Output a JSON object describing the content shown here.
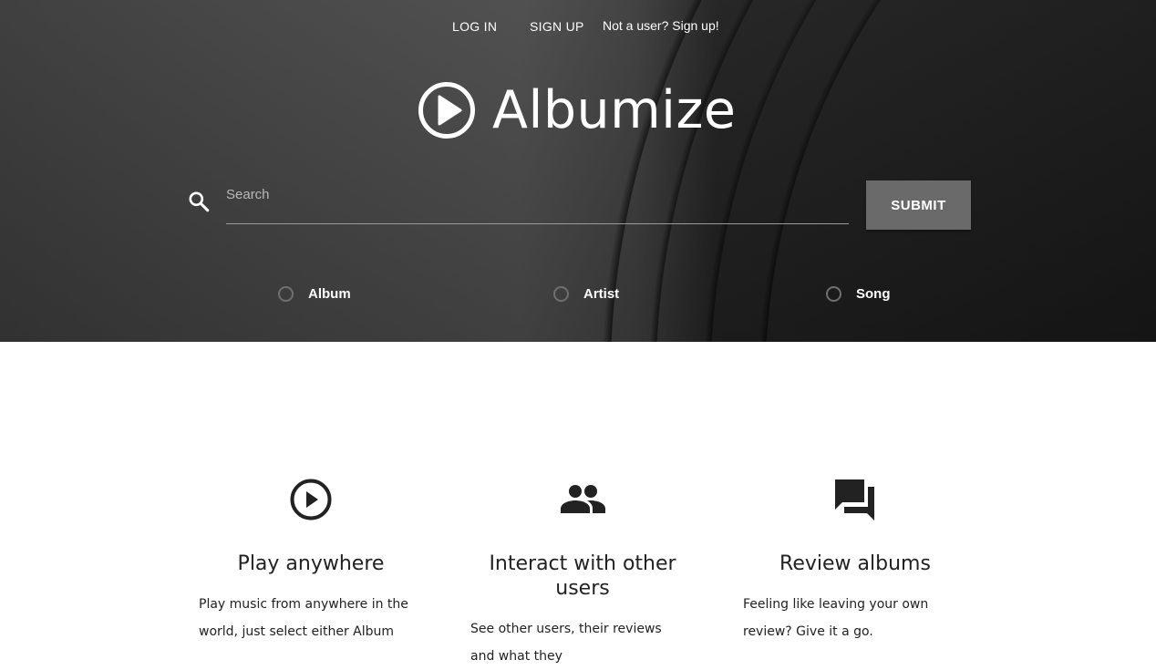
{
  "nav": {
    "login_label": "LOG IN",
    "signup_label": "SIGN UP",
    "cta_label": "Not a user? Sign up!"
  },
  "brand": {
    "name": "Albumize",
    "icon": "play-circle-icon"
  },
  "search": {
    "placeholder": "Search",
    "value": "",
    "icon": "search-icon",
    "submit_label": "SUBMIT"
  },
  "search_types": [
    {
      "label": "Album",
      "selected": false
    },
    {
      "label": "Artist",
      "selected": false
    },
    {
      "label": "Song",
      "selected": false
    }
  ],
  "features": [
    {
      "icon": "play-circle-outline-icon",
      "title": "Play anywhere",
      "text": "Play music from anywhere in the world, just select either Album"
    },
    {
      "icon": "people-icon",
      "title": "Interact with other users",
      "text": "See other users, their reviews and what they"
    },
    {
      "icon": "forum-icon",
      "title": "Review albums",
      "text": "Feeling like leaving your own review? Give it a go."
    }
  ],
  "colors": {
    "hero_background": "#3a3a3a",
    "submit_button": "#6a6a6a",
    "text_dark": "#222222",
    "text_light": "#ffffff"
  }
}
